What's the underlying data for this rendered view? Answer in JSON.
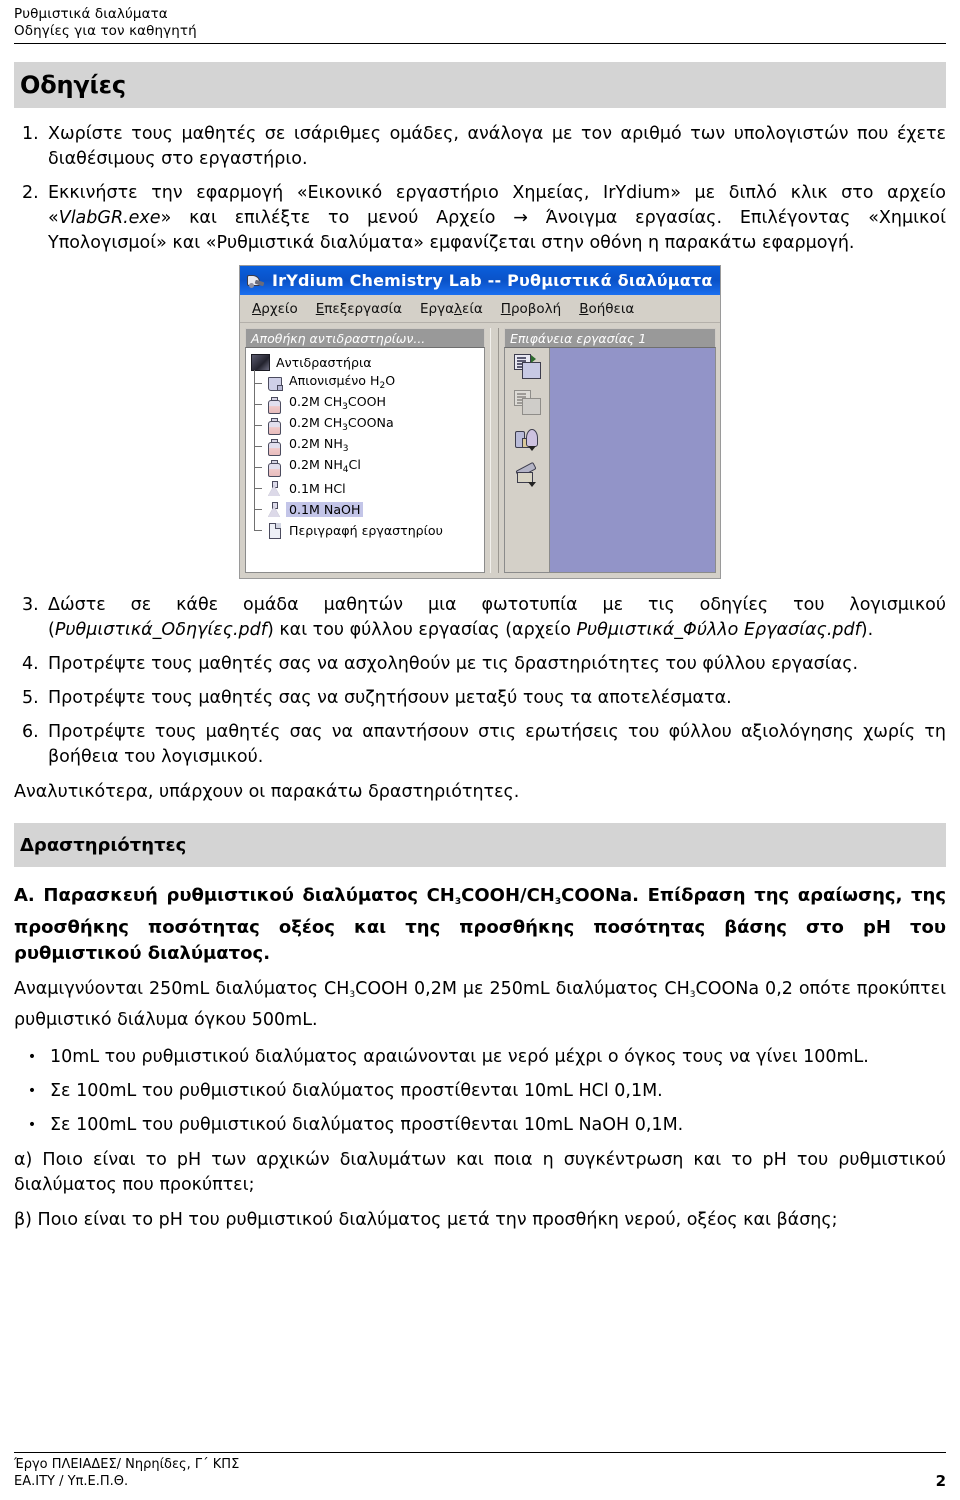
{
  "header": {
    "line1": "Ρυθμιστικά διαλύματα",
    "line2": "Οδηγίες για τον καθηγητή"
  },
  "banner": {
    "title": "Οδηγίες"
  },
  "steps": [
    {
      "num": "1.",
      "parts": [
        {
          "t": "Χωρίστε τους μαθητές σε ισάριθμες ομάδες, ανάλογα με τον αριθμό των υπολογιστών που έχετε διαθέσιμους στο εργαστήριο.",
          "style": "normal"
        }
      ]
    },
    {
      "num": "2.",
      "parts": [
        {
          "t": "Εκκινήστε την εφαρμογή «Εικονικό εργαστήριο Χημείας, IrYdium» με διπλό κλικ στο αρχείο «",
          "style": "normal"
        },
        {
          "t": "VlabGR.exe",
          "style": "italic"
        },
        {
          "t": "» και επιλέξτε το μενού Αρχείο → Άνοιγμα εργασίας. Επιλέγοντας «Χημικοί Υπολογισμοί» και «Ρυθμιστικά διαλύματα» εμφανίζεται στην οθόνη η παρακάτω εφαρμογή.",
          "style": "normal"
        }
      ]
    },
    {
      "num": "3.",
      "parts": [
        {
          "t": "Δώστε σε κάθε ομάδα μαθητών μια φωτοτυπία με τις οδηγίες του λογισμικού (",
          "style": "normal"
        },
        {
          "t": "Ρυθμιστικά_Οδηγίες.pdf",
          "style": "italic"
        },
        {
          "t": ") και του φύλλου εργασίας (αρχείο ",
          "style": "normal"
        },
        {
          "t": "Ρυθμιστικά_Φύλλο Εργασίας.pdf",
          "style": "italic"
        },
        {
          "t": ").",
          "style": "normal"
        }
      ]
    },
    {
      "num": "4.",
      "parts": [
        {
          "t": "Προτρέψτε τους μαθητές σας να ασχοληθούν με τις δραστηριότητες του φύλλου εργασίας.",
          "style": "normal"
        }
      ]
    },
    {
      "num": "5.",
      "parts": [
        {
          "t": "Προτρέψτε τους μαθητές σας να συζητήσουν μεταξύ τους τα αποτελέσματα.",
          "style": "normal"
        }
      ]
    },
    {
      "num": "6.",
      "parts": [
        {
          "t": "Προτρέψτε τους μαθητές σας να απαντήσουν στις ερωτήσεις του φύλλου αξιολόγησης χωρίς τη βοήθεια του λογισμικού.",
          "style": "normal"
        }
      ]
    }
  ],
  "app": {
    "title": "IrYdium Chemistry Lab -- Ρυθμιστικά διαλύματα",
    "title_icon": "flask-pour-icon",
    "menu": [
      {
        "label": "Αρχείο",
        "mnemonic": "Α"
      },
      {
        "label": "Επεξεργασία",
        "mnemonic": "Ε"
      },
      {
        "label": "Εργαλεία",
        "mnemonic": "λ"
      },
      {
        "label": "Προβολή",
        "mnemonic": "Π"
      },
      {
        "label": "Βοήθεια",
        "mnemonic": "Β"
      }
    ],
    "left_panel": {
      "header": "Αποθήκη αντιδραστηρίων...",
      "root": {
        "label": "Αντιδραστήρια",
        "icon": "cabinet-icon"
      },
      "items": [
        {
          "label": "Απιονισμένο H2O",
          "icon": "beaker-icon",
          "selected": false,
          "formula": [
            "Απιονισμένο H",
            "2",
            "O"
          ]
        },
        {
          "label": "0.2M CH3COOH",
          "icon": "bottle-icon",
          "selected": false,
          "formula": [
            "0.2M CH",
            "3",
            "COOH"
          ]
        },
        {
          "label": "0.2M CH3COONa",
          "icon": "bottle-icon",
          "selected": false,
          "formula": [
            "0.2M CH",
            "3",
            "COONa"
          ]
        },
        {
          "label": "0.2M NH3",
          "icon": "bottle-icon",
          "selected": false,
          "formula": [
            "0.2M NH",
            "3",
            ""
          ]
        },
        {
          "label": "0.2M NH4Cl",
          "icon": "bottle-icon",
          "selected": false,
          "formula": [
            "0.2M NH",
            "4",
            "Cl"
          ]
        },
        {
          "label": "0.1M HCl",
          "icon": "flask-icon",
          "selected": false,
          "formula": [
            "0.1M HCl",
            "",
            ""
          ]
        },
        {
          "label": "0.1M NaOH",
          "icon": "flask-icon",
          "selected": true,
          "formula": [
            "0.1M NaOH",
            "",
            ""
          ]
        },
        {
          "label": "Περιγραφή εργαστηρίου",
          "icon": "document-icon",
          "selected": false,
          "formula": [
            "Περιγραφή εργαστηρίου",
            "",
            ""
          ]
        }
      ]
    },
    "right_panel": {
      "header": "Επιφάνεια εργασίας 1",
      "workspace_color": "#9294c8",
      "tools": [
        {
          "name": "new-workspace-icon",
          "enabled": true
        },
        {
          "name": "copy-workspace-icon",
          "enabled": false
        },
        {
          "name": "glassware-icon",
          "enabled": true
        },
        {
          "name": "tools-icon",
          "enabled": true
        }
      ]
    }
  },
  "analytics_note": "Αναλυτικότερα, υπάρχουν οι παρακάτω δραστηριότητες.",
  "banner2": {
    "title": "Δραστηριότητες"
  },
  "sectionA": {
    "parts": [
      {
        "t": "Α. Παρασκευή ρυθμιστικού διαλύματος CH",
        "sub": null
      },
      {
        "t": "3",
        "sub": true
      },
      {
        "t": "COOH/CH",
        "sub": null
      },
      {
        "t": "3",
        "sub": true
      },
      {
        "t": "COONa. Επίδραση της αραίωσης, της προσθήκης ποσότητας οξέος και της προσθήκης ποσότητας βάσης στο pH του ρυθμιστικού διαλύματος.",
        "sub": null
      }
    ]
  },
  "mixPara": {
    "parts": [
      {
        "t": "Αναμιγνύονται 250mL διαλύματος CH",
        "sub": null
      },
      {
        "t": "3",
        "sub": true
      },
      {
        "t": "COOH 0,2M με 250mL διαλύματος CH",
        "sub": null
      },
      {
        "t": "3",
        "sub": true
      },
      {
        "t": "COONa 0,2 οπότε προκύπτει ρυθμιστικό διάλυμα όγκου 500mL.",
        "sub": null
      }
    ]
  },
  "bullets": [
    {
      "dot": "•",
      "text": "10mL του ρυθμιστικού διαλύματος αραιώνονται με νερό μέχρι ο όγκος τους να γίνει 100mL."
    },
    {
      "dot": "•",
      "text": "Σε 100mL του ρυθμιστικού διαλύματος προστίθενται 10mL HCl 0,1M."
    },
    {
      "dot": "•",
      "text": "Σε 100mL του ρυθμιστικού διαλύματος προστίθενται 10mL NaOH 0,1M."
    }
  ],
  "questions": [
    "α) Ποιο είναι το pH των αρχικών διαλυμάτων και ποια η συγκέντρωση και το pH του ρυθμιστικού διαλύματος που προκύπτει;",
    "β) Ποιο είναι το pH του ρυθμιστικού διαλύματος μετά την προσθήκη νερού, οξέος και βάσης;"
  ],
  "footer": {
    "line1": "Έργο ΠΛΕΙΑΔΕΣ/ Νηρηίδες, Γ΄ ΚΠΣ",
    "line2": "ΕΑ.ΙΤΥ / Υπ.Ε.Π.Θ.",
    "page": "2"
  }
}
